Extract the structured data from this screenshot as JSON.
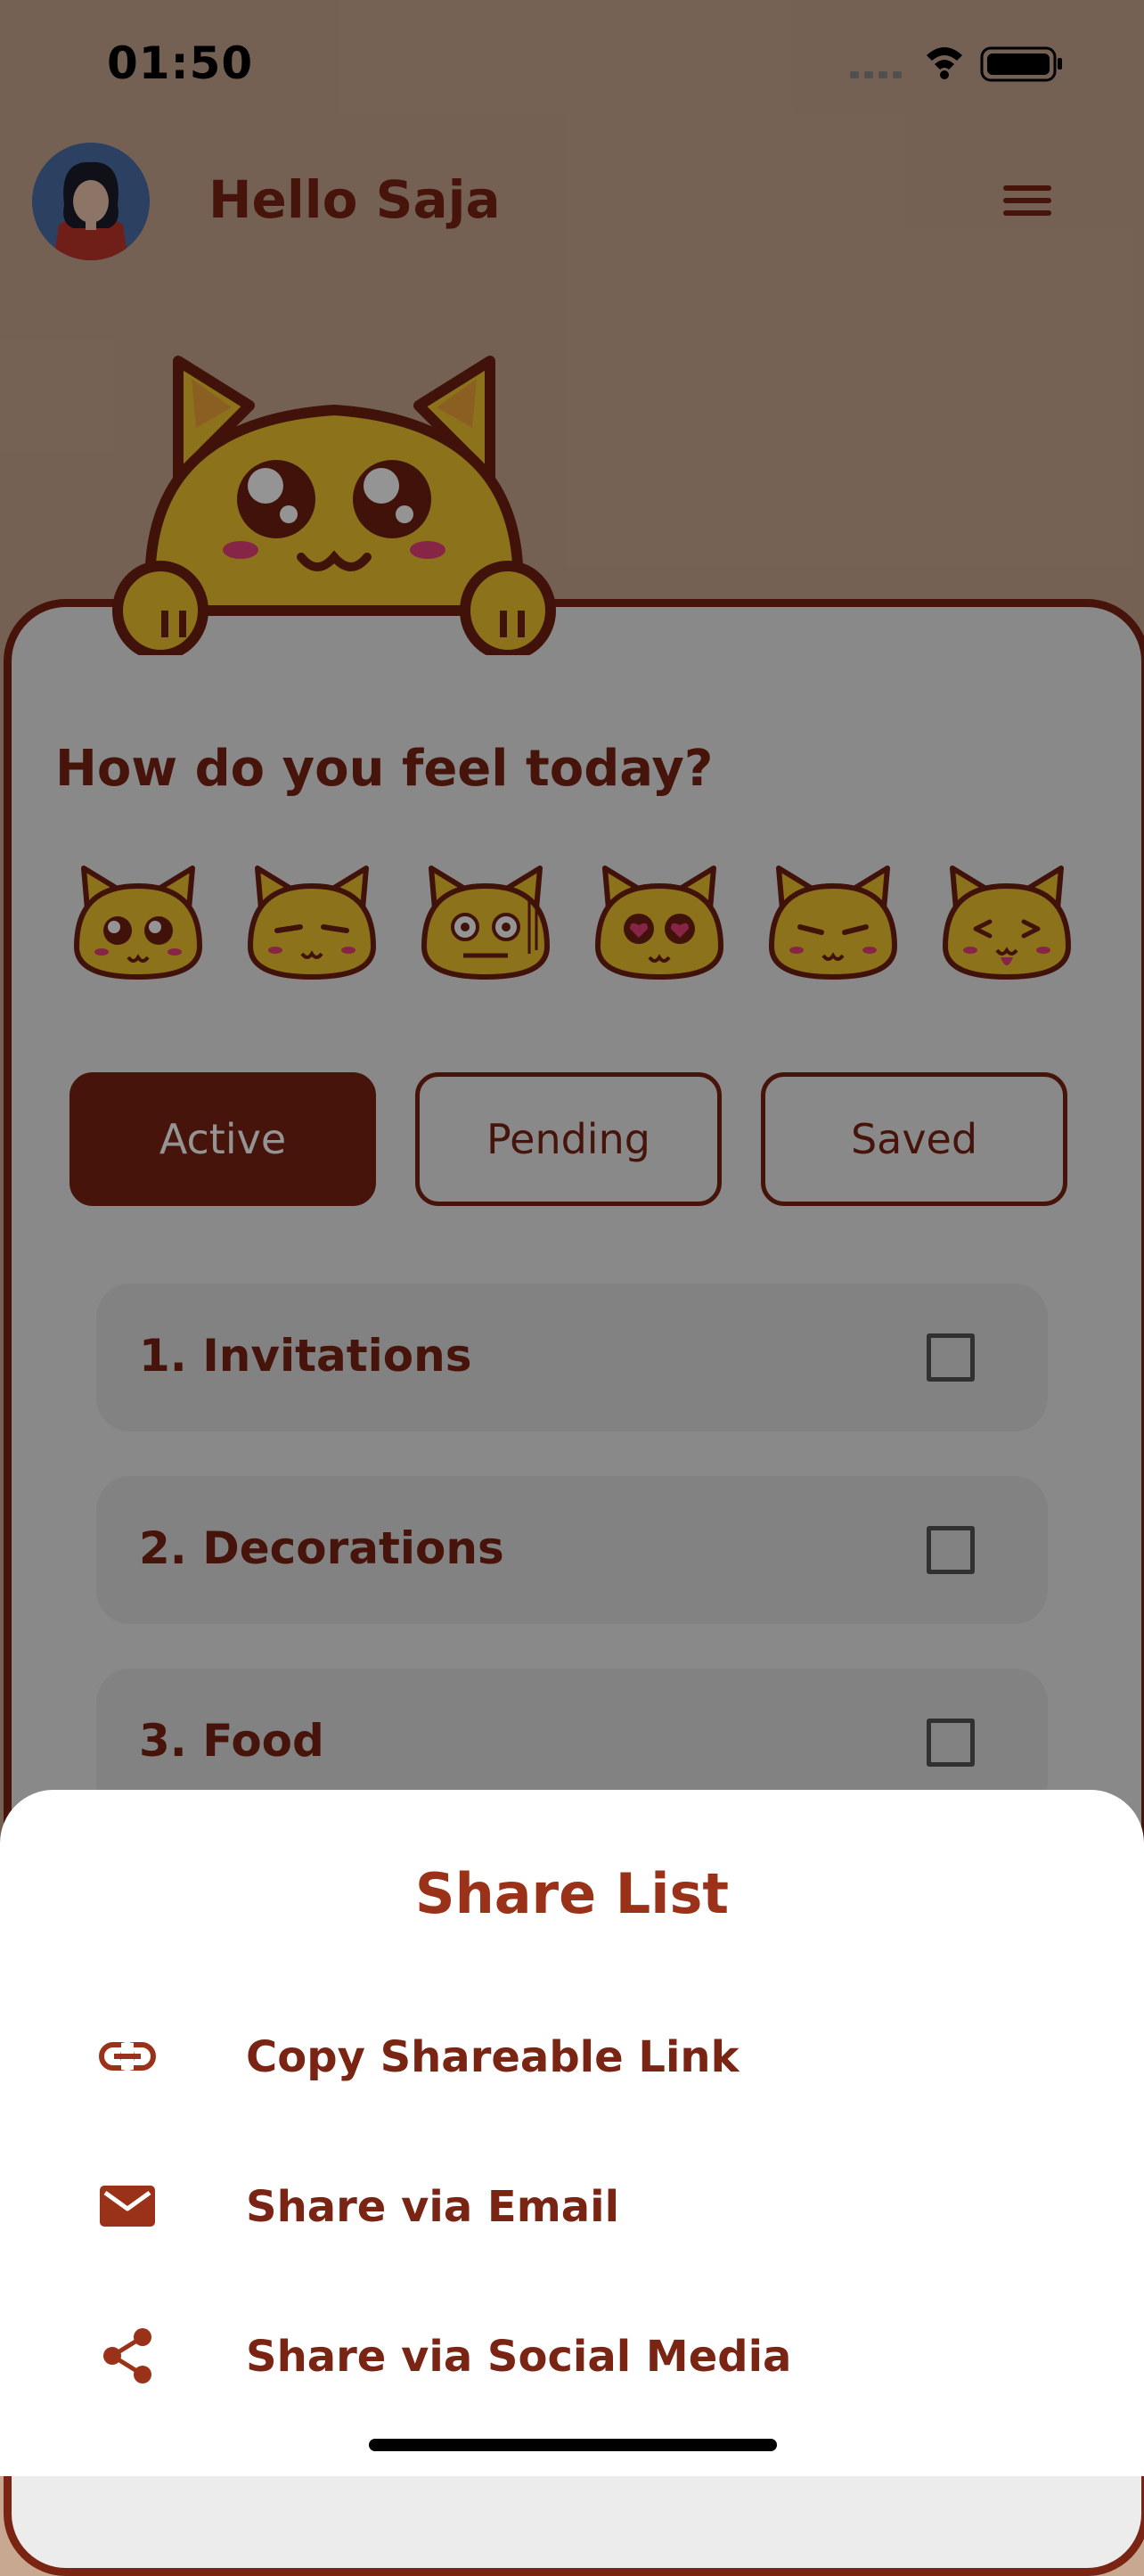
{
  "status_bar": {
    "time": "01:50"
  },
  "header": {
    "greeting": "Hello Saja",
    "avatar": "user-avatar",
    "menu_icon": "hamburger-menu-icon"
  },
  "colors": {
    "brand": "#7a2414",
    "accent": "#9a3219",
    "mascot": "#f2c530",
    "card": "#ececec"
  },
  "mood_section": {
    "question": "How do you feel today?",
    "moods": [
      "happy-cat-icon",
      "content-cat-icon",
      "nervous-cat-icon",
      "love-cat-icon",
      "sad-cat-icon",
      "playful-cat-icon"
    ]
  },
  "tabs": [
    {
      "label": "Active",
      "selected": true
    },
    {
      "label": "Pending",
      "selected": false
    },
    {
      "label": "Saved",
      "selected": false
    }
  ],
  "tasks": [
    {
      "label": "1. Invitations",
      "checked": false
    },
    {
      "label": "2. Decorations",
      "checked": false
    },
    {
      "label": "3. Food",
      "checked": false
    }
  ],
  "share_sheet": {
    "title": "Share List",
    "options": [
      {
        "label": "Copy Shareable Link",
        "icon": "link-icon"
      },
      {
        "label": "Share via Email",
        "icon": "email-icon"
      },
      {
        "label": "Share via Social Media",
        "icon": "share-icon"
      }
    ]
  }
}
